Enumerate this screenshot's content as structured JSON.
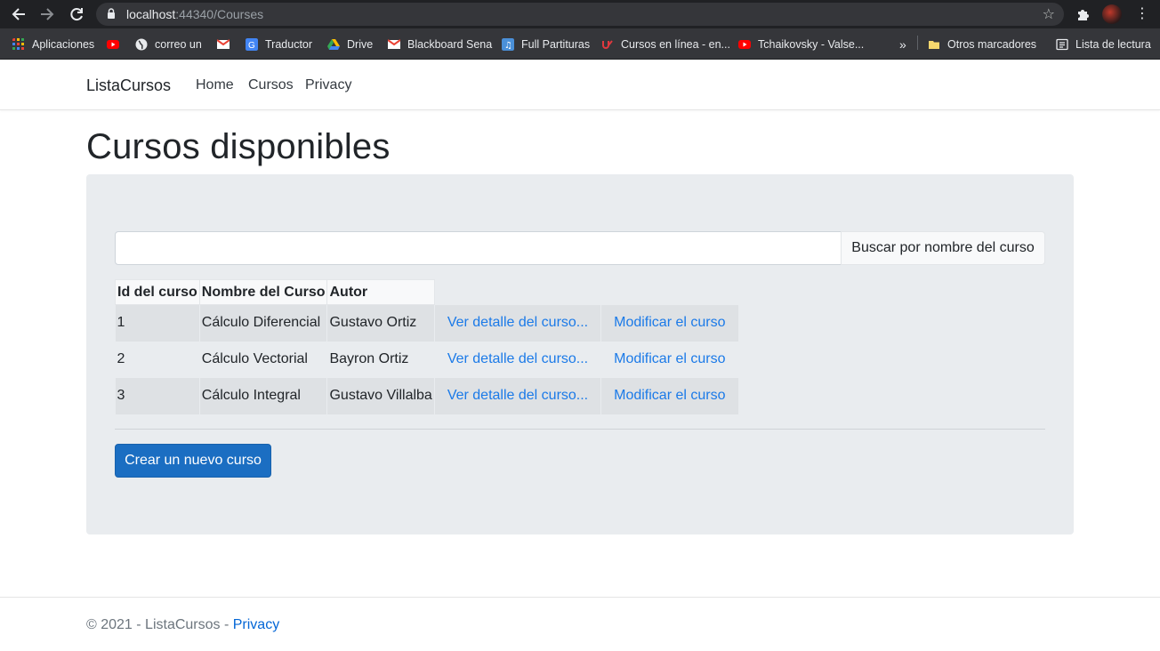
{
  "browser": {
    "url_host": "localhost",
    "url_rest": ":44340/Courses",
    "bookmarks": [
      {
        "label": "Aplicaciones",
        "icon": "apps-grid-icon",
        "color": "#ea4335"
      },
      {
        "label": "",
        "icon": "youtube-icon",
        "color": "#ff0000"
      },
      {
        "label": "correo un",
        "icon": "globe-icon",
        "color": "#e8eaed"
      },
      {
        "label": "",
        "icon": "gmail-icon",
        "color": "#ea4335"
      },
      {
        "label": "Traductor",
        "icon": "translate-icon",
        "color": "#4285f4"
      },
      {
        "label": "Drive",
        "icon": "drive-icon",
        "color": "#34a853"
      },
      {
        "label": "Blackboard Sena",
        "icon": "gmail-icon",
        "color": "#ea4335"
      },
      {
        "label": "Full Partituras",
        "icon": "music-icon",
        "color": "#4a90d9"
      },
      {
        "label": "Cursos en línea - en...",
        "icon": "udemy-icon",
        "color": "#e0383e"
      },
      {
        "label": "Tchaikovsky - Valse...",
        "icon": "youtube-icon",
        "color": "#ff0000"
      }
    ],
    "more_label": "»",
    "other_bookmarks": "Otros marcadores",
    "reading_list": "Lista de lectura"
  },
  "site": {
    "brand": "ListaCursos",
    "nav": [
      "Home",
      "Cursos",
      "Privacy"
    ]
  },
  "main": {
    "title": "Cursos disponibles",
    "search_placeholder": "",
    "search_button": "Buscar por nombre del curso",
    "table": {
      "headers": [
        "Id del curso",
        "Nombre del Curso",
        "Autor"
      ],
      "rows": [
        {
          "id": "1",
          "name": "Cálculo Diferencial",
          "author": "Gustavo Ortiz",
          "detail": "Ver detalle del curso...",
          "edit": "Modificar el curso"
        },
        {
          "id": "2",
          "name": "Cálculo Vectorial",
          "author": "Bayron Ortiz",
          "detail": "Ver detalle del curso...",
          "edit": "Modificar el curso"
        },
        {
          "id": "3",
          "name": "Cálculo Integral",
          "author": "Gustavo Villalba",
          "detail": "Ver detalle del curso...",
          "edit": "Modificar el curso"
        }
      ]
    },
    "create_button": "Crear un nuevo curso"
  },
  "footer": {
    "text": "© 2021 - ListaCursos - ",
    "link": "Privacy"
  },
  "colors": {
    "link": "#1b7ae8",
    "primary_button": "#1b6ec2",
    "jumbotron": "#e9ecef"
  }
}
